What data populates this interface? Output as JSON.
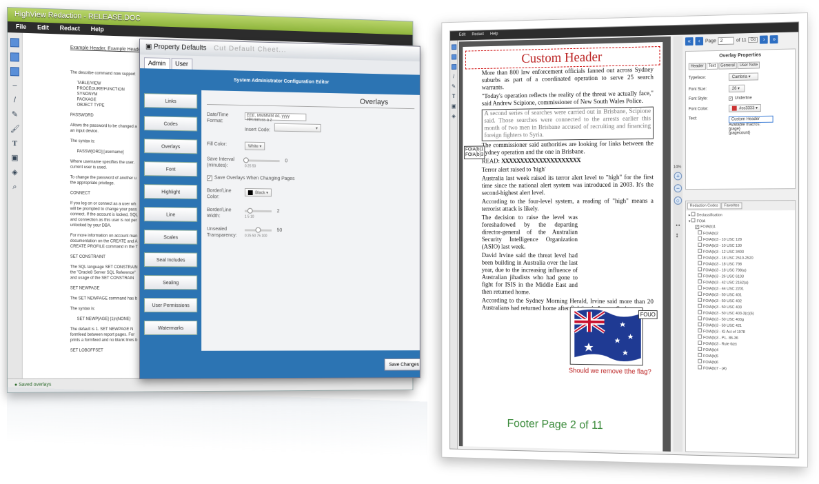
{
  "left_window": {
    "title": "HighView Redaction - RELEASE.DOC",
    "menu": [
      "File",
      "Edit",
      "Redact",
      "Help"
    ],
    "doc_header": "Example Header, Example Header",
    "doc_lines": [
      "The describe command now support",
      "TABLE/VIEW",
      "PROCEDURE/FUNCTION",
      "SYNONYM",
      "PACKAGE",
      "OBJECT TYPE",
      "PASSWORD",
      "Allows the password to be changed a",
      "an input device.",
      "The syntax is:",
      "PASSW[ORD] [username]",
      "Where username specifies the user.",
      "current user is used.",
      "To change the password of another u",
      "the appropriate privilege.",
      "CONNECT",
      "If you log on or connect as a user wh",
      "will be prompted to change your pass",
      "connect. If the account is locked, SQL",
      "and connection as this user is not per",
      "unlocked by your DBA.",
      "For more information on account man",
      "documentation on the CREATE and A",
      "CREATE PROFILE command in the T",
      "SET CONSTRAINT",
      "The SQL language SET CONSTRAIN",
      "the \"Oracle8 Server SQL Reference\"",
      "and usage of the SET CONSTRAIN",
      "SET NEWPAGE",
      "The SET NEWPAGE command has b",
      "The syntax is:",
      "SET NEWP[AGE] {1|n|NONE}",
      "The default is 1. SET NEWPAGE N",
      "formfeed between report pages. For",
      "prints a formfeed and no blank lines b",
      "SET LOBOFFSET"
    ],
    "status": "Saved overlays"
  },
  "property_defaults": {
    "title": "Property Defaults",
    "title_blur": "Cut Default Cheet...",
    "tabs": [
      "Admin",
      "User"
    ],
    "banner": "System Administrator Configuration Editor",
    "side_buttons": [
      "Links",
      "Codes",
      "Overlays",
      "Font",
      "Highlight",
      "Line",
      "Scales",
      "Seal Includes",
      "Sealing",
      "User Permissions",
      "Watermarks"
    ],
    "section_title": "Overlays",
    "date_time_label": "Date/Time Format:",
    "date_time_value": "EEE, MMMMM dd, yyyy HH:mm:ss a z",
    "insert_code_label": "Insert Code:",
    "fill_color_label": "Fill Color:",
    "fill_color_value": "White",
    "save_interval_label": "Save Interval (minutes):",
    "save_interval_value": "0",
    "save_interval_ticks": "0   25   50",
    "save_overlays_label": "Save Overlays When Changing Pages",
    "border_color_label": "Border/Line Color:",
    "border_color_value": "Black",
    "border_width_label": "Border/Line Width:",
    "border_width_value": "2",
    "border_width_ticks": "1   5   10",
    "unsealed_label": "Unsealed Transparency:",
    "unsealed_value": "50",
    "unsealed_ticks": "0  25 50 75 100",
    "save_button": "Save Changes"
  },
  "right_window": {
    "menu": [
      "Edit",
      "Redact",
      "Help"
    ],
    "custom_header": "Custom Header",
    "article": [
      "More than 800 law enforcement officials fanned out across Sydney suburbs as part of a coordinated operation to serve 25 search warrants.",
      "\"Today's operation reflects the reality of the threat we actually face,\" said Andrew Scipione, commissioner of New South Wales Police."
    ],
    "redacted_block": "A second series of searches were carried out in Brisbane, Scipione said. Those searches were connected to the arrests earlier this month of two men in Brisbane accused of recruiting and financing foreign fighters to Syria.",
    "foia_label_1": "FOIA(b)1",
    "foia_label_2": "FOIA(b)3",
    "article_2": [
      "The commissioner said authorities are looking for links between the Sydney operation and the one in Brisbane.",
      "Terror alert raised to 'high'",
      "Australia last week raised its terror alert level to \"high\" for the first time since the national alert system was introduced in 2003. It's the second-highest alert level.",
      "According to the four-level system, a reading of \"high\" means a terrorist attack is likely.",
      "The decision to raise the level was foreshadowed by the departing director-general of the Australian Security Intelligence Organization (ASIO) last week.",
      "David Irvine said the threat level had been building in Australia over the last year, due to the increasing influence of Australian jihadists who had gone to fight for ISIS in the Middle East and then returned home.",
      "According to the Sydney Morning Herald, Irvine said more than 20 Australians had returned home after fighting in Iraq or Syria."
    ],
    "read_label": "READ:",
    "strike_text": "XXXXXXXXXXXXXXXXXXXXX",
    "fouo": "FOUO",
    "flag_question": "Should we remove tthe flag?",
    "footer": "Footer Page 2 of 11",
    "zoom": "14%",
    "nav": {
      "page_label": "Page",
      "page_value": "2",
      "of_label": "of 11",
      "go": "Go"
    },
    "overlay_props": {
      "title": "Overlay Properties",
      "tabs": [
        "Header",
        "Text",
        "General",
        "User Note"
      ],
      "typeface_label": "Typeface:",
      "typeface_value": "Cambria",
      "size_label": "Font Size:",
      "size_value": "26",
      "style_label": "Font Style:",
      "style_value": "Underline",
      "color_label": "Font Color:",
      "color_value": "#cc3333",
      "text_label": "Text:",
      "text_value": "Custom Header",
      "macros": [
        "Available macros:",
        "{page}",
        "{pagecount}"
      ]
    },
    "codes_tabs": [
      "Redaction Codes",
      "Favorites"
    ],
    "codes": [
      {
        "label": "Declassification",
        "level": 0,
        "checked": false
      },
      {
        "label": "FOIA",
        "level": 0,
        "checked": false
      },
      {
        "label": "FOIA(b)1",
        "level": 1,
        "checked": true
      },
      {
        "label": "FOIA(b)2",
        "level": 2,
        "checked": false
      },
      {
        "label": "FOIA(b)3 - 10 USC 128",
        "level": 2,
        "checked": false
      },
      {
        "label": "FOIA(b)3 - 10 USC 130",
        "level": 2,
        "checked": false
      },
      {
        "label": "FOIA(b)3 - 12 USC 3403",
        "level": 2,
        "checked": false
      },
      {
        "label": "FOIA(b)3 - 18 USC 2510-2520",
        "level": 2,
        "checked": false
      },
      {
        "label": "FOIA(b)3 - 18 USC 798",
        "level": 2,
        "checked": false
      },
      {
        "label": "FOIA(b)3 - 18 USC 798(a)",
        "level": 2,
        "checked": false
      },
      {
        "label": "FOIA(b)3 - 26 USC 6103",
        "level": 2,
        "checked": false
      },
      {
        "label": "FOIA(b)3 - 42 USC 2162(a)",
        "level": 2,
        "checked": false
      },
      {
        "label": "FOIA(b)3 - 44 USC 2201",
        "level": 2,
        "checked": false
      },
      {
        "label": "FOIA(b)3 - 50 USC 401",
        "level": 2,
        "checked": false
      },
      {
        "label": "FOIA(b)3 - 50 USC 402",
        "level": 2,
        "checked": false
      },
      {
        "label": "FOIA(b)3 - 50 USC 403",
        "level": 2,
        "checked": false
      },
      {
        "label": "FOIA(b)3 - 50 USC 403-3(c)(6)",
        "level": 2,
        "checked": false
      },
      {
        "label": "FOIA(b)3 - 50 USC 403g",
        "level": 2,
        "checked": false
      },
      {
        "label": "FOIA(b)3 - 50 USC 421",
        "level": 2,
        "checked": false
      },
      {
        "label": "FOIA(b)3 - IG Act of 1978",
        "level": 2,
        "checked": false
      },
      {
        "label": "FOIA(b)3 - P.L. 86-36",
        "level": 2,
        "checked": false
      },
      {
        "label": "FOIA(b)3 - Rule 6(e)",
        "level": 2,
        "checked": false
      },
      {
        "label": "FOIA(b)4",
        "level": 2,
        "checked": false
      },
      {
        "label": "FOIA(b)5",
        "level": 2,
        "checked": false
      },
      {
        "label": "FOIA(b)6",
        "level": 2,
        "checked": false
      },
      {
        "label": "FOIA(b)7 - (A)",
        "level": 2,
        "checked": false
      }
    ]
  },
  "colors": {
    "brand_blue": "#2c74b3",
    "header_red": "#b22222",
    "footer_green": "#3a8a3a"
  }
}
